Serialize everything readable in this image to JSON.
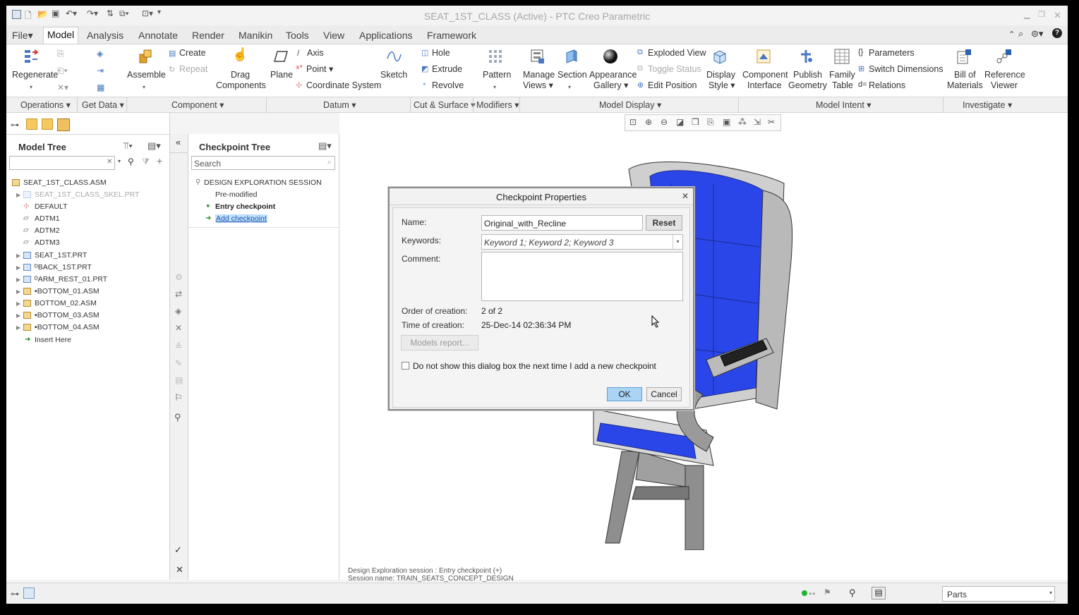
{
  "window": {
    "title": "SEAT_1ST_CLASS (Active) - PTC Creo Parametric"
  },
  "menu": [
    "File",
    "Model",
    "Analysis",
    "Annotate",
    "Render",
    "Manikin",
    "Tools",
    "View",
    "Applications",
    "Framework"
  ],
  "ribbon": {
    "regenerate": "Regenerate",
    "assemble": "Assemble",
    "create": "Create",
    "repeat": "Repeat",
    "drag1": "Drag",
    "drag2": "Components",
    "plane": "Plane",
    "axis": "Axis",
    "point": "Point",
    "coord": "Coordinate System",
    "sketch": "Sketch",
    "hole": "Hole",
    "extrude": "Extrude",
    "revolve": "Revolve",
    "pattern": "Pattern",
    "manage1": "Manage",
    "manage2": "Views",
    "section": "Section",
    "appearance1": "Appearance",
    "appearance2": "Gallery",
    "exploded": "Exploded View",
    "toggle": "Toggle Status",
    "editpos": "Edit Position",
    "display1": "Display",
    "display2": "Style",
    "compif1": "Component",
    "compif2": "Interface",
    "publish1": "Publish",
    "publish2": "Geometry",
    "family1": "Family",
    "family2": "Table",
    "parameters": "Parameters",
    "switchdim": "Switch Dimensions",
    "relations": "Relations",
    "bom1": "Bill of",
    "bom2": "Materials",
    "refview1": "Reference",
    "refview2": "Viewer"
  },
  "groups": [
    "Operations",
    "Get Data",
    "Component",
    "Datum",
    "Cut & Surface",
    "Modifiers",
    "Model Display",
    "Model Intent",
    "Investigate"
  ],
  "model_tree": {
    "title": "Model Tree",
    "items": [
      "SEAT_1ST_CLASS.ASM",
      "SEAT_1ST_CLASS_SKEL.PRT",
      "DEFAULT",
      "ADTM1",
      "ADTM2",
      "ADTM3",
      "SEAT_1ST.PRT",
      "BACK_1ST.PRT",
      "ARM_REST_01.PRT",
      "BOTTOM_01.ASM",
      "BOTTOM_02.ASM",
      "BOTTOM_03.ASM",
      "BOTTOM_04.ASM",
      "Insert Here"
    ]
  },
  "checkpoint_tree": {
    "title": "Checkpoint Tree",
    "search_placeholder": "Search",
    "session": "DESIGN EXPLORATION SESSION",
    "items": [
      "Pre-modified",
      "Entry checkpoint",
      "Add checkpoint"
    ]
  },
  "dialog": {
    "title": "Checkpoint Properties",
    "name_label": "Name:",
    "name_value": "Original_with_Recline",
    "reset": "Reset",
    "keywords_label": "Keywords:",
    "keywords_value": "Keyword 1; Keyword 2; Keyword 3",
    "comment_label": "Comment:",
    "order_label": "Order of creation:",
    "order_value": "2 of 2",
    "time_label": "Time of creation:",
    "time_value": "25-Dec-14 02:36:34 PM",
    "models_report": "Models report...",
    "checkbox_label": "Do not show this dialog box the next time I add a new checkpoint",
    "ok": "OK",
    "cancel": "Cancel"
  },
  "session_info": {
    "line1": "Design Exploration session : Entry checkpoint (+)",
    "line2": "Session name: TRAIN_SEATS_CONCEPT_DESIGN"
  },
  "status": {
    "filter": "Parts"
  },
  "colors": {
    "seat_blue": "#2b46e8",
    "ok_button": "#a9d4f5"
  }
}
